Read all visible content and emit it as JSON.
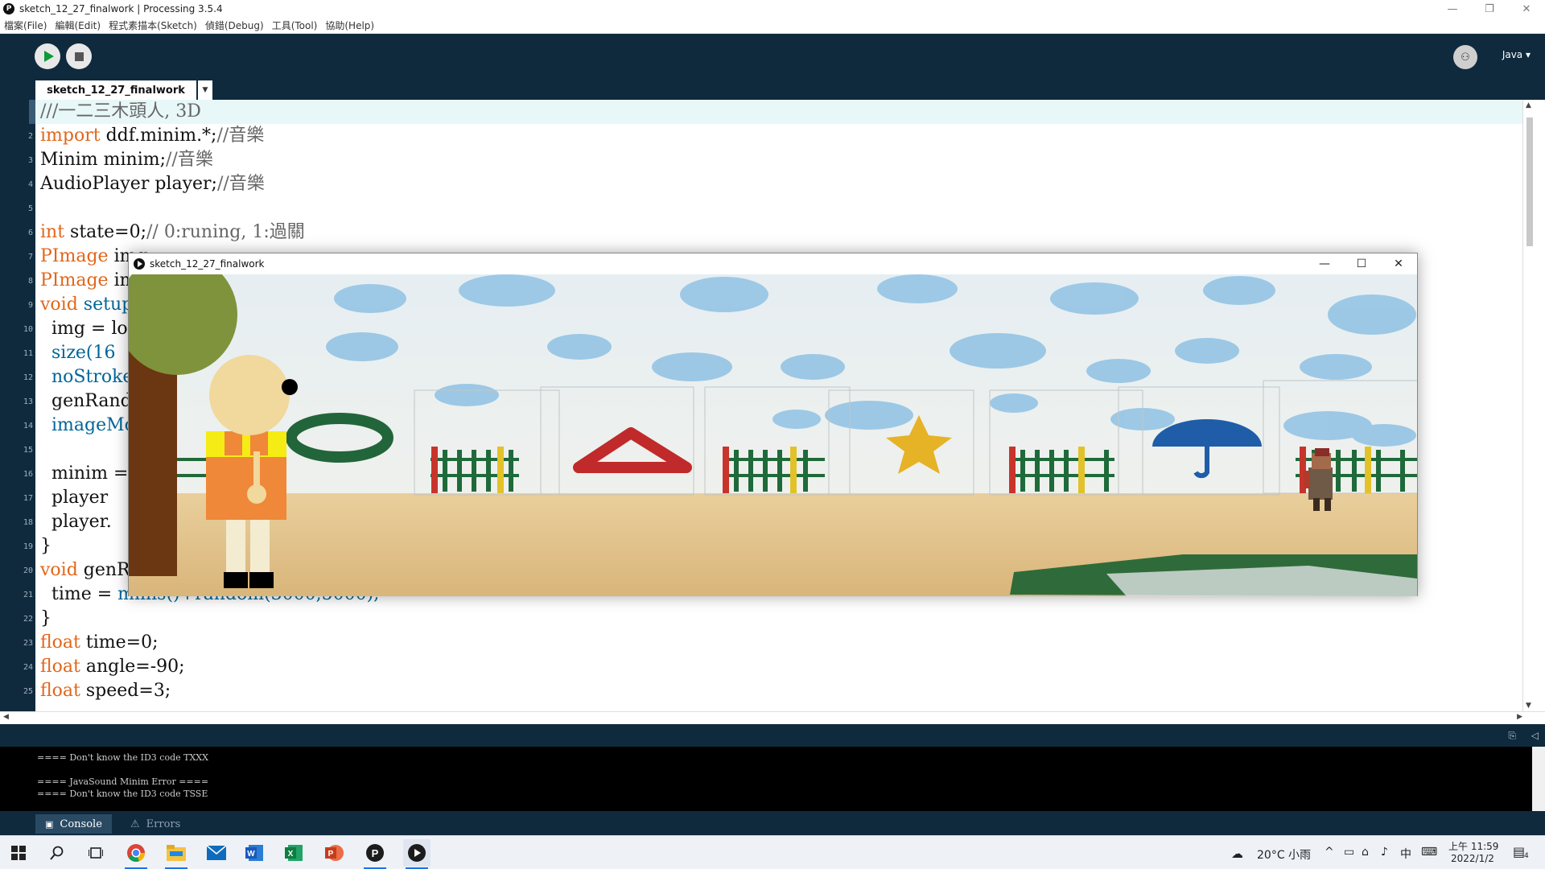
{
  "window": {
    "title": "sketch_12_27_finalwork | Processing 3.5.4",
    "minimize": "—",
    "maximize": "❐",
    "close": "✕"
  },
  "menu": [
    "檔案(File)",
    "編輯(Edit)",
    "程式素描本(Sketch)",
    "偵錯(Debug)",
    "工具(Tool)",
    "協助(Help)"
  ],
  "toolbar": {
    "mode_label": "Java ▾"
  },
  "tab": {
    "name": "sketch_12_27_finalwork",
    "arrow": "▼"
  },
  "code": {
    "line_numbers": [
      "1",
      "2",
      "3",
      "4",
      "5",
      "6",
      "7",
      "8",
      "9",
      "10",
      "11",
      "12",
      "13",
      "14",
      "15",
      "16",
      "17",
      "18",
      "19",
      "20",
      "21",
      "22",
      "23",
      "24",
      "25"
    ],
    "lines": [
      {
        "k": "",
        "t": "///一二三木頭人, 3D",
        "cls": "cm"
      },
      {
        "k": "import",
        "t": " ddf.minim.*;",
        "c": "//音樂"
      },
      {
        "k": "",
        "t": "Minim minim;",
        "c": "//音樂"
      },
      {
        "k": "",
        "t": "AudioPlayer player;",
        "c": "//音樂"
      },
      {
        "k": "",
        "t": ""
      },
      {
        "k": "int",
        "t": " state=0;",
        "c": "// 0:runing, 1:過關"
      },
      {
        "k": "PImage",
        "t": " img"
      },
      {
        "k": "PImage",
        "t": " img"
      },
      {
        "k": "void",
        "t": "",
        "f": " setup"
      },
      {
        "k": "",
        "t": "  img = lo"
      },
      {
        "k": "",
        "t": "",
        "f": "  size(16"
      },
      {
        "k": "",
        "t": "",
        "f": "  noStroke"
      },
      {
        "k": "",
        "t": "  genRando"
      },
      {
        "k": "",
        "t": "",
        "f": "  imageMod"
      },
      {
        "k": "",
        "t": ""
      },
      {
        "k": "",
        "t": "  minim = "
      },
      {
        "k": "",
        "t": "  player "
      },
      {
        "k": "",
        "t": "  player."
      },
      {
        "k": "",
        "t": "}"
      },
      {
        "k": "void",
        "t": " genRa"
      },
      {
        "k": "",
        "t": "  time = ",
        "f": "millis()+random(3000,5000);"
      },
      {
        "k": "",
        "t": "}"
      },
      {
        "k": "float",
        "t": " time=0;"
      },
      {
        "k": "float",
        "t": " angle=-90;"
      },
      {
        "k": "float",
        "t": " speed=3;"
      }
    ]
  },
  "console": {
    "lines": [
      "==== Don't know the ID3 code TXXX",
      "",
      "==== JavaSound Minim Error ====",
      "==== Don't know the ID3 code TSSE"
    ],
    "tab_console": "Console",
    "tab_errors": "Errors"
  },
  "sketch_window": {
    "title": "sketch_12_27_finalwork",
    "minimize": "—",
    "maximize": "☐",
    "close": "✕"
  },
  "taskbar": {
    "weather": "20°C  小雨",
    "ime": "中",
    "time": "上午 11:59",
    "date": "2022/1/2",
    "notification_count": "4"
  },
  "colors": {
    "toolbar_bg": "#0f2a3d",
    "keyword": "#e2661a",
    "function": "#006699",
    "comment": "#666666",
    "play_green": "#0c9a3a"
  }
}
